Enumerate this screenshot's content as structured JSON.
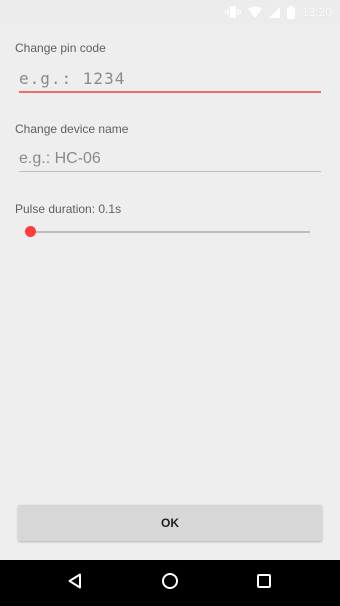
{
  "status_bar": {
    "time": "13:20",
    "icons": [
      "vibrate-icon",
      "wifi-icon",
      "signal-icon",
      "battery-icon"
    ]
  },
  "form": {
    "pin_label": "Change pin code",
    "pin_placeholder": "e.g.: 1234",
    "pin_value": "",
    "device_label": "Change device name",
    "device_placeholder": "e.g.: HC-06",
    "device_value": "",
    "pulse_label": "Pulse duration: 0.1s",
    "pulse_level": 0
  },
  "ok_button_label": "OK",
  "nav_bar": {
    "icons": [
      "back-icon",
      "home-icon",
      "recents-icon"
    ]
  },
  "colors": {
    "accent": "#ff4b4b",
    "focused_underline": "#f06b6b",
    "background": "#eeeeee",
    "nav_background": "#000000"
  }
}
